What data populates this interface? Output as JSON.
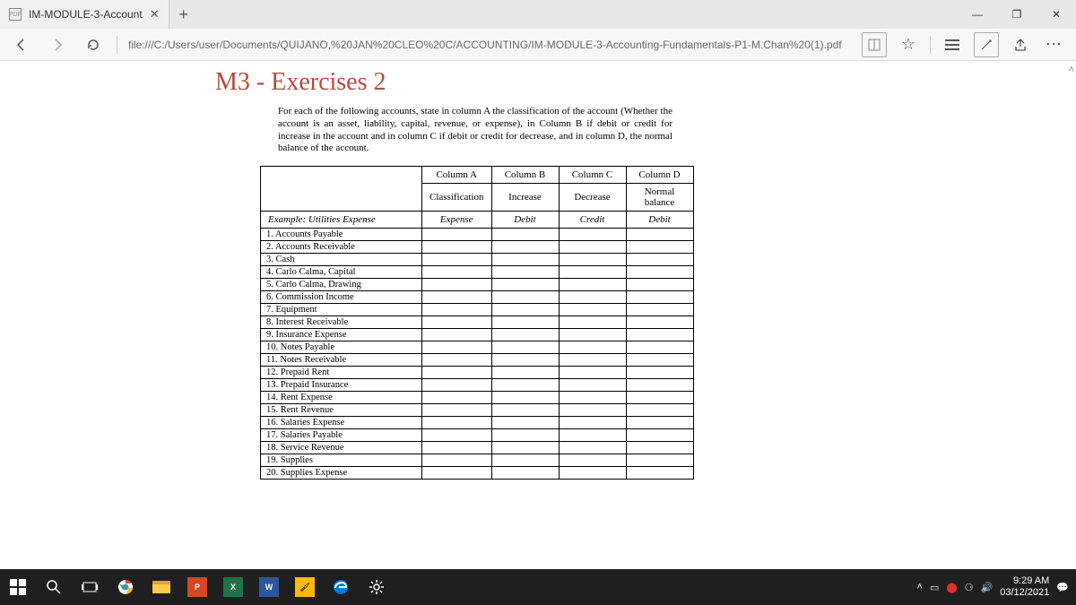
{
  "tab": {
    "title": "IM-MODULE-3-Account",
    "close": "✕",
    "plus": "+"
  },
  "win": {
    "min": "—",
    "max": "❐",
    "close": "✕"
  },
  "toolbar": {
    "url": "file:///C:/Users/user/Documents/QUIJANO,%20JAN%20CLEO%20C/ACCOUNTING/IM-MODULE-3-Accounting-Fundamentals-P1-M.Chan%20(1).pdf",
    "star": "☆",
    "more": "⋯"
  },
  "doc": {
    "heading": "M3 - Exercises 2",
    "intro": "For each of the following accounts, state in column A the classification of the account (Whether the account is an asset, liability, capital, revenue, or expense), in Column B if debit or credit for increase in the account and in column C if debit or credit for decrease, and in column D, the normal balance of the account.",
    "colA1": "Column A",
    "colB1": "Column B",
    "colC1": "Column C",
    "colD1": "Column D",
    "colA2": "Classification",
    "colB2": "Increase",
    "colC2": "Decrease",
    "colD2": "Normal balance",
    "example_label": "Example:  Utilities Expense",
    "exA": "Expense",
    "exB": "Debit",
    "exC": "Credit",
    "exD": "Debit",
    "accounts": [
      "1.   Accounts Payable",
      "2.   Accounts Receivable",
      "3.   Cash",
      "4.   Carlo Calma, Capital",
      "5.   Carlo Calma, Drawing",
      "6.   Commission Income",
      "7.   Equipment",
      "8.   Interest Receivable",
      "9.   Insurance Expense",
      "10. Notes Payable",
      "11. Notes Receivable",
      "12. Prepaid Rent",
      "13. Prepaid Insurance",
      "14. Rent Expense",
      "15. Rent Revenue",
      "16. Salaries Expense",
      "17. Salaries Payable",
      "18. Service Revenue",
      "19. Supplies",
      "20. Supplies Expense"
    ]
  },
  "tray": {
    "up": "˄",
    "time": "9:29 AM",
    "date": "03/12/2021"
  }
}
